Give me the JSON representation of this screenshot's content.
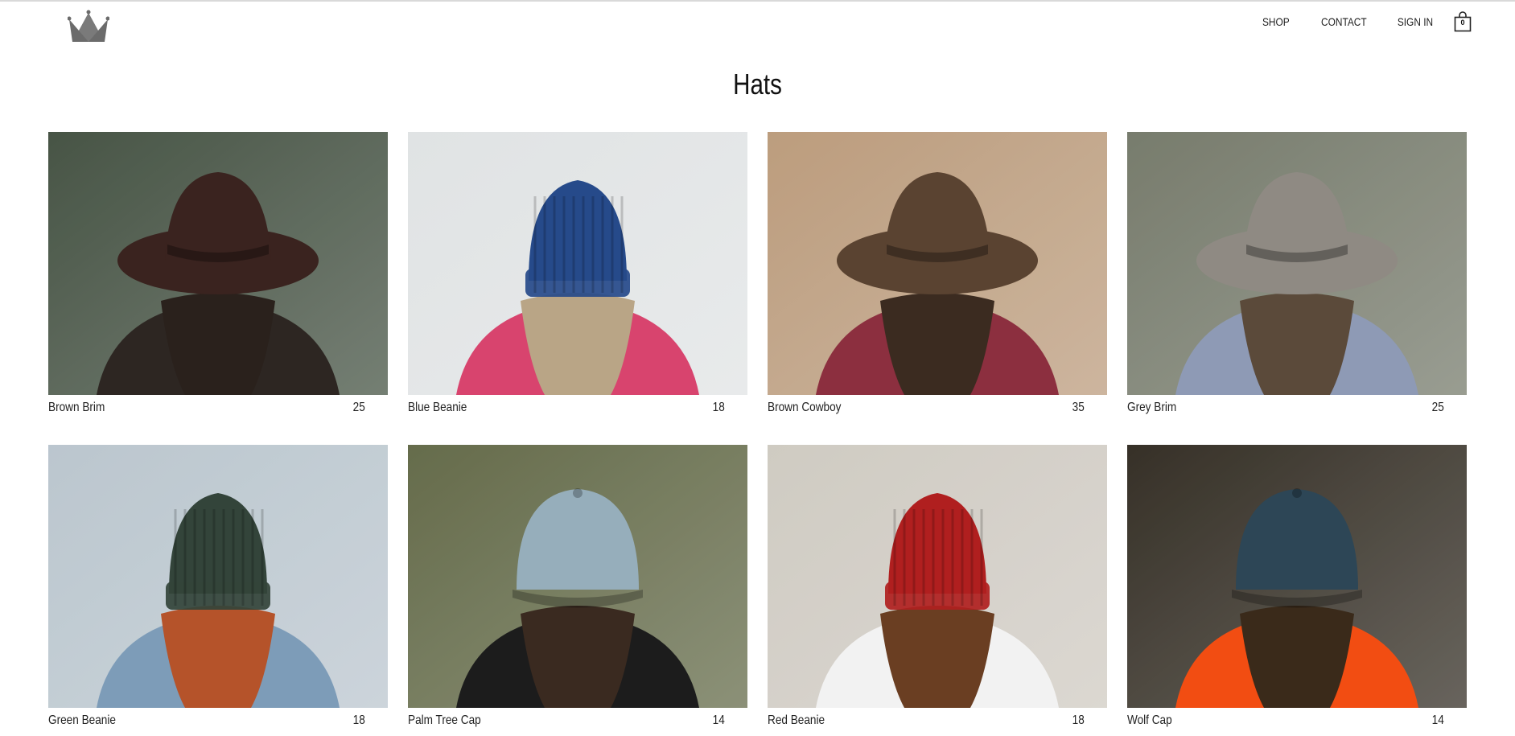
{
  "header": {
    "logo_icon": "crown-icon",
    "nav": [
      {
        "label": "SHOP"
      },
      {
        "label": "CONTACT"
      },
      {
        "label": "SIGN IN"
      }
    ],
    "cart": {
      "icon": "shopping-bag-icon",
      "count": "0"
    }
  },
  "page": {
    "title": "Hats"
  },
  "products": [
    {
      "name": "Brown Brim",
      "price": "25",
      "colors": {
        "bg": "#3c4a3a",
        "hat": "#3a231f",
        "hair": "#2a211c",
        "body": "#2d2622"
      }
    },
    {
      "name": "Blue Beanie",
      "price": "18",
      "colors": {
        "bg": "#dfe2e3",
        "hat": "#264a8a",
        "hair": "#b9a586",
        "body": "#d8446e"
      }
    },
    {
      "name": "Brown Cowboy",
      "price": "35",
      "colors": {
        "bg": "#b89776",
        "hat": "#5a4331",
        "hair": "#3b2b20",
        "body": "#8c2f3f"
      }
    },
    {
      "name": "Grey Brim",
      "price": "25",
      "colors": {
        "bg": "#6f7464",
        "hat": "#8f8a83",
        "hair": "#5b4a3a",
        "body": "#8e9ab5"
      }
    },
    {
      "name": "Green Beanie",
      "price": "18",
      "colors": {
        "bg": "#b7c3cc",
        "hat": "#33443a",
        "hair": "#b5532a",
        "body": "#7d9cb8"
      }
    },
    {
      "name": "Palm Tree Cap",
      "price": "14",
      "colors": {
        "bg": "#5c6340",
        "hat": "#96aebb",
        "hair": "#3a2a20",
        "body": "#1c1c1c"
      }
    },
    {
      "name": "Red Beanie",
      "price": "18",
      "colors": {
        "bg": "#cdc8bf",
        "hat": "#b01f1f",
        "hair": "#6a3e22",
        "body": "#f2f2f2"
      }
    },
    {
      "name": "Wolf Cap",
      "price": "14",
      "colors": {
        "bg": "#2a241a",
        "hat": "#2d4656",
        "hair": "#3a2a1a",
        "body": "#f24d12"
      }
    }
  ]
}
